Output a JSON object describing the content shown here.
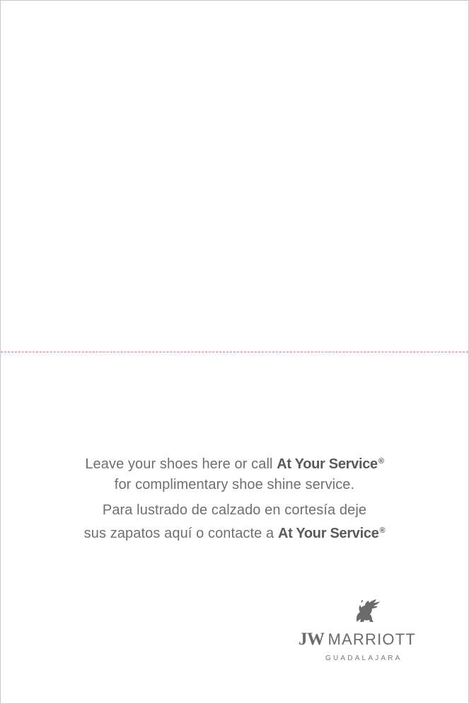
{
  "card": {
    "english": {
      "line1_prefix": "Leave your shoes here or call ",
      "line1_brand": "At Your Service",
      "line1_reg": "®",
      "line2": "for complimentary shoe shine service."
    },
    "spanish": {
      "line1": "Para lustrado de calzado en cortesía deje",
      "line2_prefix": "sus zapatos aquí o contacte a ",
      "line2_brand": "At Your Service",
      "line2_reg": "®"
    }
  },
  "logo": {
    "icon": "griffin-icon",
    "jw": "JW",
    "marriott": "MARRIOTT",
    "city": "GUADALAJARA"
  },
  "colors": {
    "text": "#6f6f6f",
    "brand": "#5a5a5a",
    "fold_line": "#e060c0",
    "border": "#c8c8c8"
  }
}
